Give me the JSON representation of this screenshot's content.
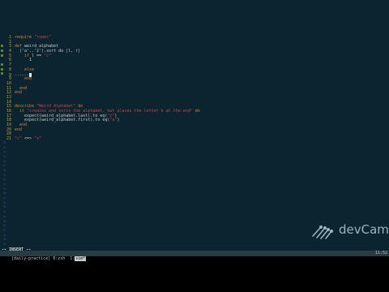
{
  "editor": {
    "lines": [
      {
        "n": "1",
        "segs": [
          {
            "t": "require ",
            "c": "kw"
          },
          {
            "t": "\"rspec\"",
            "c": "str"
          }
        ]
      },
      {
        "n": "2",
        "segs": []
      },
      {
        "n": "3",
        "segs": [
          {
            "t": "def ",
            "c": "kw"
          },
          {
            "t": "weird_alphabet",
            "c": "plain"
          }
        ]
      },
      {
        "n": "4",
        "segs": [
          {
            "t": "  ('a'..'z').sort do |l, r|",
            "c": "plain"
          }
        ]
      },
      {
        "n": "5",
        "segs": [
          {
            "t": "    if ",
            "c": "kw"
          },
          {
            "t": "l == ",
            "c": "plain"
          },
          {
            "t": "\"c\"",
            "c": "str"
          }
        ]
      },
      {
        "n": "6",
        "segs": [
          {
            "t": "      1",
            "c": "plain"
          }
        ]
      },
      {
        "n": "7",
        "segs": []
      },
      {
        "n": "8",
        "segs": [
          {
            "t": "    else",
            "c": "kw"
          }
        ]
      },
      {
        "n": "9",
        "segs": [
          {
            "t": "------",
            "c": "plain"
          }
        ],
        "cursor": true
      },
      {
        "n": "9",
        "segs": [
          {
            "t": "    end",
            "c": "kw"
          }
        ]
      },
      {
        "n": "10",
        "segs": []
      },
      {
        "n": "11",
        "segs": [
          {
            "t": "  end",
            "c": "kw"
          }
        ]
      },
      {
        "n": "12",
        "segs": [
          {
            "t": "end",
            "c": "kw"
          }
        ]
      },
      {
        "n": "13",
        "segs": []
      },
      {
        "n": "14",
        "segs": []
      },
      {
        "n": "15",
        "segs": [
          {
            "t": "describe ",
            "c": "kw"
          },
          {
            "t": "\"Weird Alphabet\" ",
            "c": "str"
          },
          {
            "t": "do",
            "c": "kw"
          }
        ]
      },
      {
        "n": "16",
        "segs": [
          {
            "t": "  it ",
            "c": "kw"
          },
          {
            "t": "\"creates and sorts the alphabet, but places the letter k at the end\" ",
            "c": "str"
          },
          {
            "t": "do",
            "c": "kw"
          }
        ]
      },
      {
        "n": "17",
        "segs": [
          {
            "t": "    expect(weird_alphabet.last).to eq(",
            "c": "plain"
          },
          {
            "t": "\"c\"",
            "c": "str"
          },
          {
            "t": ")",
            "c": "plain"
          }
        ]
      },
      {
        "n": "18",
        "segs": [
          {
            "t": "    expect(weird_alphabet.first).to eq(",
            "c": "plain"
          },
          {
            "t": "\"a\"",
            "c": "str"
          },
          {
            "t": ")",
            "c": "plain"
          }
        ]
      },
      {
        "n": "19",
        "segs": [
          {
            "t": "  end",
            "c": "kw"
          }
        ]
      },
      {
        "n": "20",
        "segs": [
          {
            "t": "end",
            "c": "kw"
          }
        ]
      },
      {
        "n": "20",
        "segs": []
      },
      {
        "n": "21",
        "segs": [
          {
            "t": "\"c\" ",
            "c": "str"
          },
          {
            "t": "<=> ",
            "c": "plain"
          },
          {
            "t": "\"z\"",
            "c": "str"
          }
        ]
      }
    ],
    "tilde_count": 24,
    "tilde": "~"
  },
  "status": {
    "mode": "-- INSERT --"
  },
  "tmux": {
    "session": "[daily-practice] ",
    "window_prefix": "0:zsh  1:",
    "active_window": "vim*",
    "time": "11:52"
  },
  "logo": {
    "text": "devCamp"
  },
  "colors": {
    "editor_bg": "#0b2430",
    "line_number": "#b8a33a",
    "keyword": "#d3862f",
    "string": "#c24a4a",
    "tilde": "#2e7bc4",
    "status_bar": "#2a3b43"
  }
}
